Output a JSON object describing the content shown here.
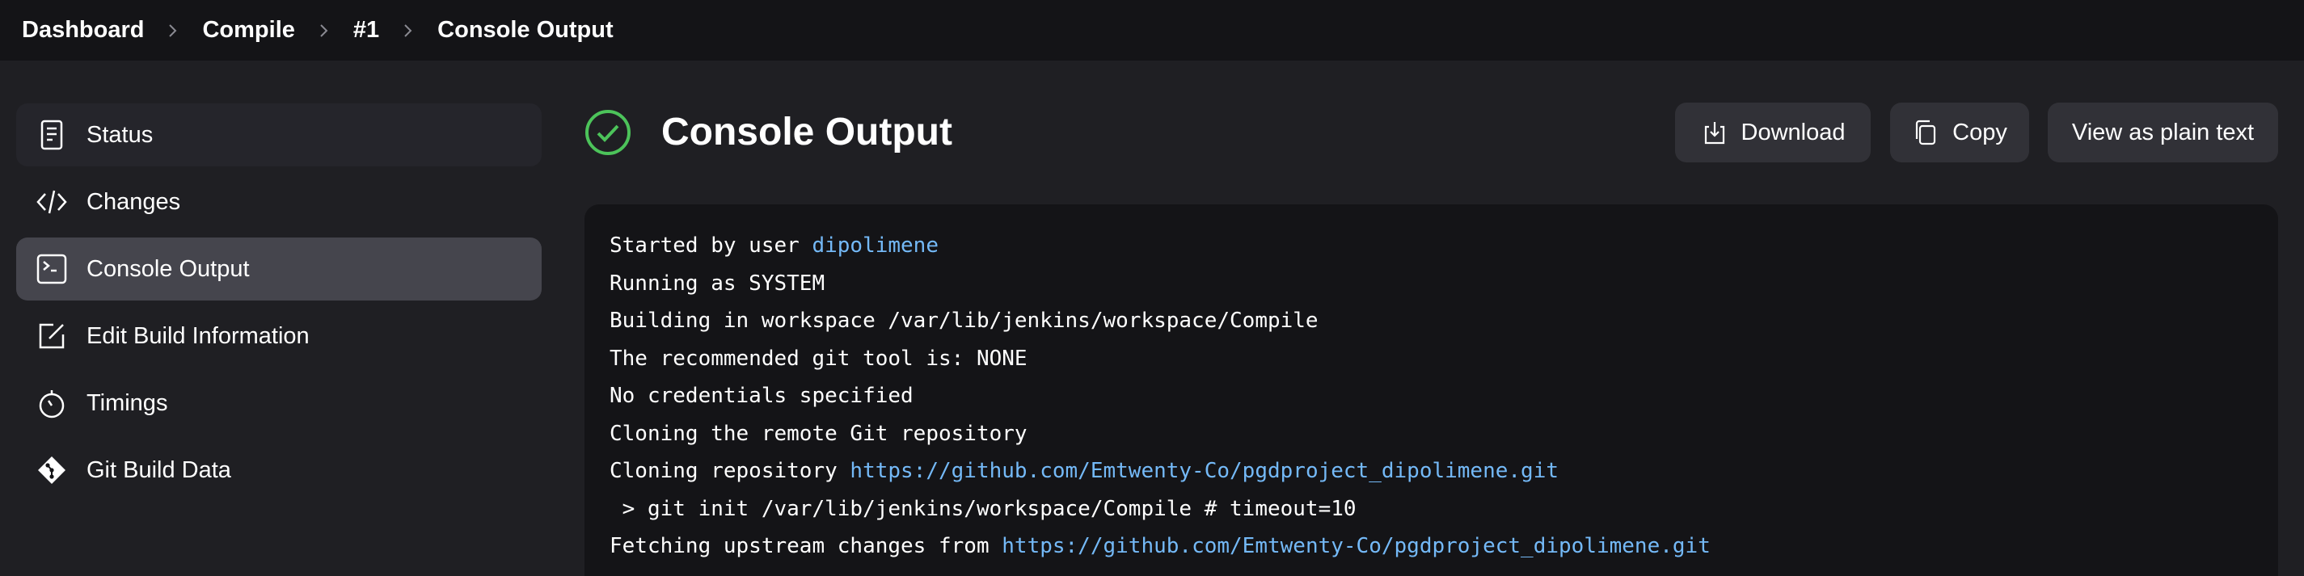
{
  "breadcrumb": {
    "items": [
      "Dashboard",
      "Compile",
      "#1",
      "Console Output"
    ]
  },
  "sidebar": {
    "items": [
      {
        "label": "Status",
        "icon": "document-icon"
      },
      {
        "label": "Changes",
        "icon": "code-icon"
      },
      {
        "label": "Console Output",
        "icon": "terminal-icon"
      },
      {
        "label": "Edit Build Information",
        "icon": "edit-icon"
      },
      {
        "label": "Timings",
        "icon": "stopwatch-icon"
      },
      {
        "label": "Git Build Data",
        "icon": "git-icon"
      }
    ],
    "active": "Console Output"
  },
  "header": {
    "title": "Console Output",
    "status_icon": "success-check-icon",
    "status_color": "#4cc35a"
  },
  "actions": {
    "download_label": "Download",
    "copy_label": "Copy",
    "plain_text_label": "View as plain text"
  },
  "console": {
    "lines": [
      {
        "text": "Started by user ",
        "link": "dipolimene"
      },
      {
        "text": "Running as SYSTEM"
      },
      {
        "text": "Building in workspace /var/lib/jenkins/workspace/Compile"
      },
      {
        "text": "The recommended git tool is: NONE"
      },
      {
        "text": "No credentials specified"
      },
      {
        "text": "Cloning the remote Git repository"
      },
      {
        "text": "Cloning repository ",
        "link": "https://github.com/Emtwenty-Co/pgdproject_dipolimene.git"
      },
      {
        "text": " > git init /var/lib/jenkins/workspace/Compile # timeout=10"
      },
      {
        "text": "Fetching upstream changes from ",
        "link": "https://github.com/Emtwenty-Co/pgdproject_dipolimene.git"
      }
    ]
  },
  "colors": {
    "background": "#1f1f23",
    "topbar": "#141417",
    "console_bg": "#141417",
    "link": "#74b9f7",
    "active_item": "#45454d"
  }
}
